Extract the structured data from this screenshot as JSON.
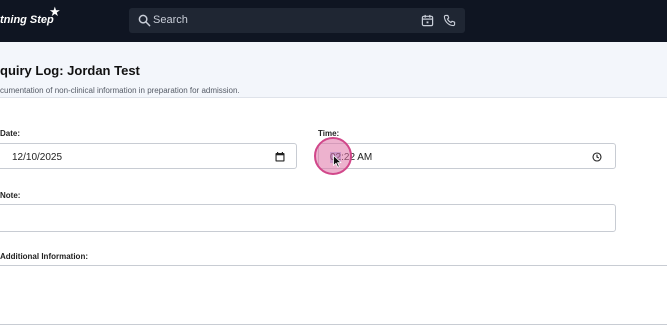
{
  "topbar": {
    "brand": "tning Step",
    "star_icon": "star-icon",
    "search_placeholder": "Search",
    "icons": [
      "search-icon",
      "calendar-icon",
      "phone-icon"
    ]
  },
  "header": {
    "title": "quiry Log: Jordan Test",
    "subtitle": "cumentation of non-clinical information in preparation for admission."
  },
  "form": {
    "date_label": "Date:",
    "date_value": "12/10/2025",
    "time_label": "Time:",
    "time_hour": "02",
    "time_rest": ":22 AM",
    "note_label": "Note:",
    "note_value": "",
    "additional_label": "Additional Information:",
    "additional_value": ""
  },
  "colors": {
    "topbar": "#0f1522",
    "header_bg": "#f3f6fb",
    "click_highlight": "#d1478a"
  }
}
